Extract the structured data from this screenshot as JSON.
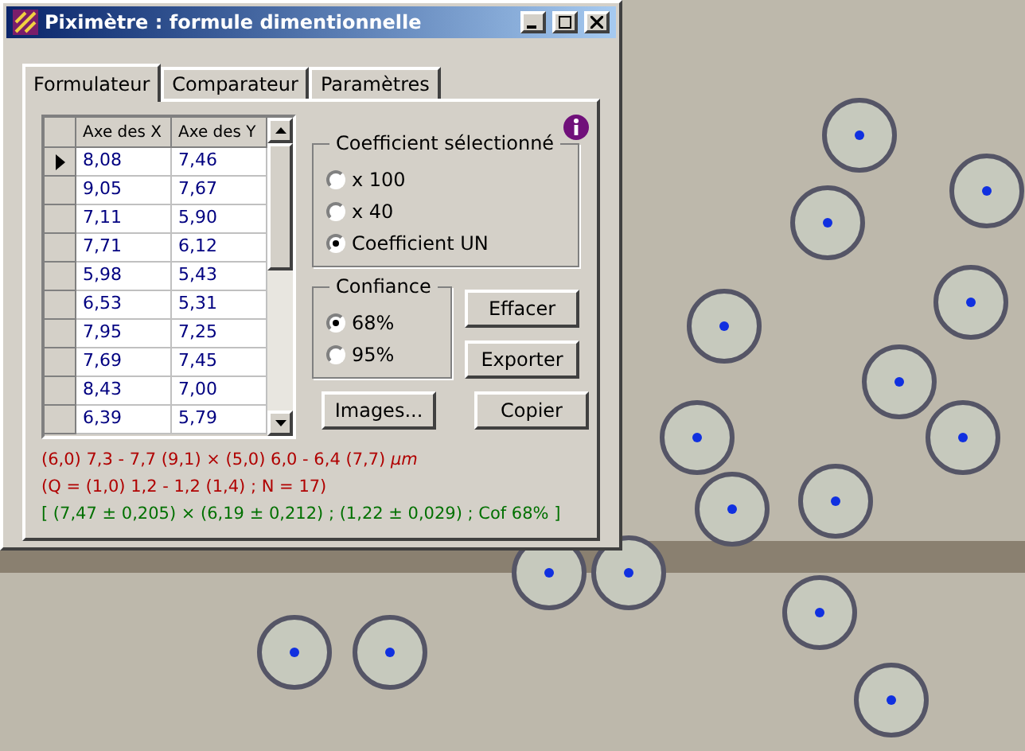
{
  "window": {
    "title": "Piximètre : formule dimentionnelle"
  },
  "tabs": [
    {
      "label": "Formulateur",
      "selected": true
    },
    {
      "label": "Comparateur",
      "selected": false
    },
    {
      "label": "Paramètres",
      "selected": false
    }
  ],
  "table": {
    "columns": [
      "Axe des X",
      "Axe des Y"
    ],
    "rows": [
      {
        "cells": [
          "8,08",
          "7,46"
        ],
        "selected": true
      },
      {
        "cells": [
          "9,05",
          "7,67"
        ],
        "selected": false
      },
      {
        "cells": [
          "7,11",
          "5,90"
        ],
        "selected": false
      },
      {
        "cells": [
          "7,71",
          "6,12"
        ],
        "selected": false
      },
      {
        "cells": [
          "5,98",
          "5,43"
        ],
        "selected": false
      },
      {
        "cells": [
          "6,53",
          "5,31"
        ],
        "selected": false
      },
      {
        "cells": [
          "7,95",
          "7,25"
        ],
        "selected": false
      },
      {
        "cells": [
          "7,69",
          "7,45"
        ],
        "selected": false
      },
      {
        "cells": [
          "8,43",
          "7,00"
        ],
        "selected": false
      },
      {
        "cells": [
          "6,39",
          "5,79"
        ],
        "selected": false
      }
    ]
  },
  "coefficient": {
    "title": "Coefficient sélectionné",
    "options": [
      {
        "label": "x 100",
        "selected": false
      },
      {
        "label": "x 40",
        "selected": false
      },
      {
        "label": "Coefficient UN",
        "selected": true
      }
    ]
  },
  "confiance": {
    "title": "Confiance",
    "options": [
      {
        "label": "68%",
        "selected": true
      },
      {
        "label": "95%",
        "selected": false
      }
    ]
  },
  "buttons": {
    "effacer": "Effacer",
    "exporter": "Exporter",
    "images": "Images...",
    "copier": "Copier"
  },
  "results": [
    {
      "text": "(6,0) 7,3 - 7,7 (9,1) × (5,0) 6,0 - 6,4 (7,7) *µm*",
      "color": "#b00000"
    },
    {
      "text": "(Q = (1,0) 1,2 - 1,2 (1,4) ; N = 17)",
      "color": "#b00000"
    },
    {
      "text": "[ (7,47 ± 0,205) × (6,19 ± 0,212) ; (1,22 ± 0,029) ; Cof 68% ]",
      "color": "#007000"
    }
  ]
}
